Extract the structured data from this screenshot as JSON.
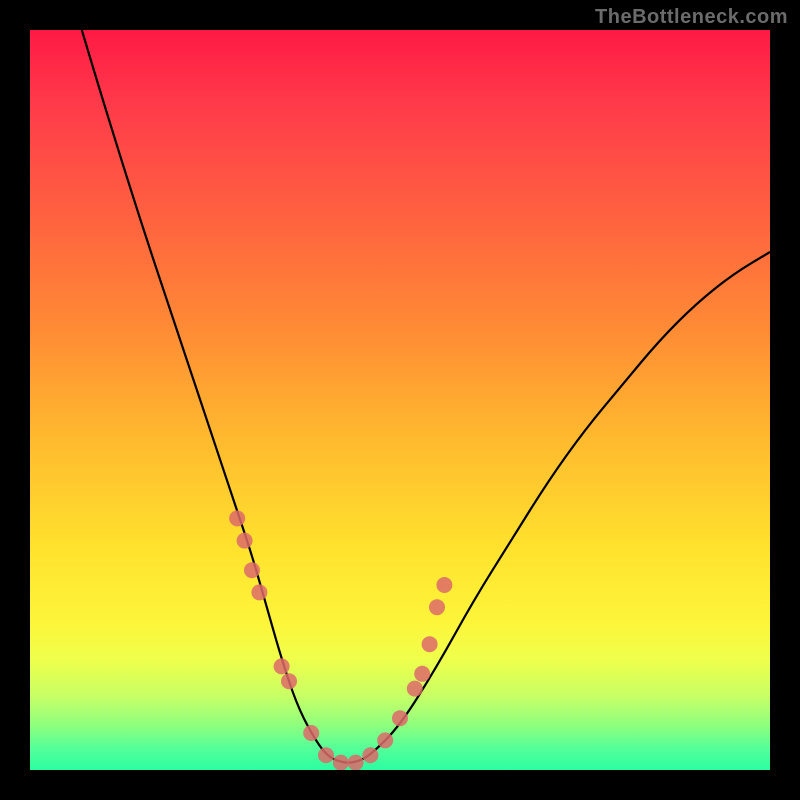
{
  "watermark": "TheBottleneck.com",
  "chart_data": {
    "type": "line",
    "title": "",
    "xlabel": "",
    "ylabel": "",
    "xlim": [
      0,
      100
    ],
    "ylim": [
      0,
      100
    ],
    "curve": {
      "x": [
        7,
        10,
        15,
        20,
        25,
        28,
        30,
        32,
        34,
        36,
        38,
        40,
        42,
        44,
        46,
        50,
        55,
        60,
        65,
        70,
        75,
        80,
        85,
        90,
        95,
        100
      ],
      "y": [
        100,
        90,
        74,
        59,
        44,
        35,
        29,
        22,
        15,
        9,
        5,
        2,
        1,
        1,
        2,
        6,
        14,
        23,
        31,
        39,
        46,
        52,
        58,
        63,
        67,
        70
      ]
    },
    "markers": {
      "x": [
        28,
        29,
        30,
        31,
        34,
        35,
        38,
        40,
        42,
        44,
        46,
        48,
        50,
        52,
        53,
        54,
        55,
        56
      ],
      "y": [
        34,
        31,
        27,
        24,
        14,
        12,
        5,
        2,
        1,
        1,
        2,
        4,
        7,
        11,
        13,
        17,
        22,
        25
      ],
      "color": "#dd6a6a",
      "radius": 8
    },
    "gradient_colors": {
      "top": "#ff1a44",
      "mid": "#ffe22d",
      "bottom": "#2bffa2"
    }
  }
}
